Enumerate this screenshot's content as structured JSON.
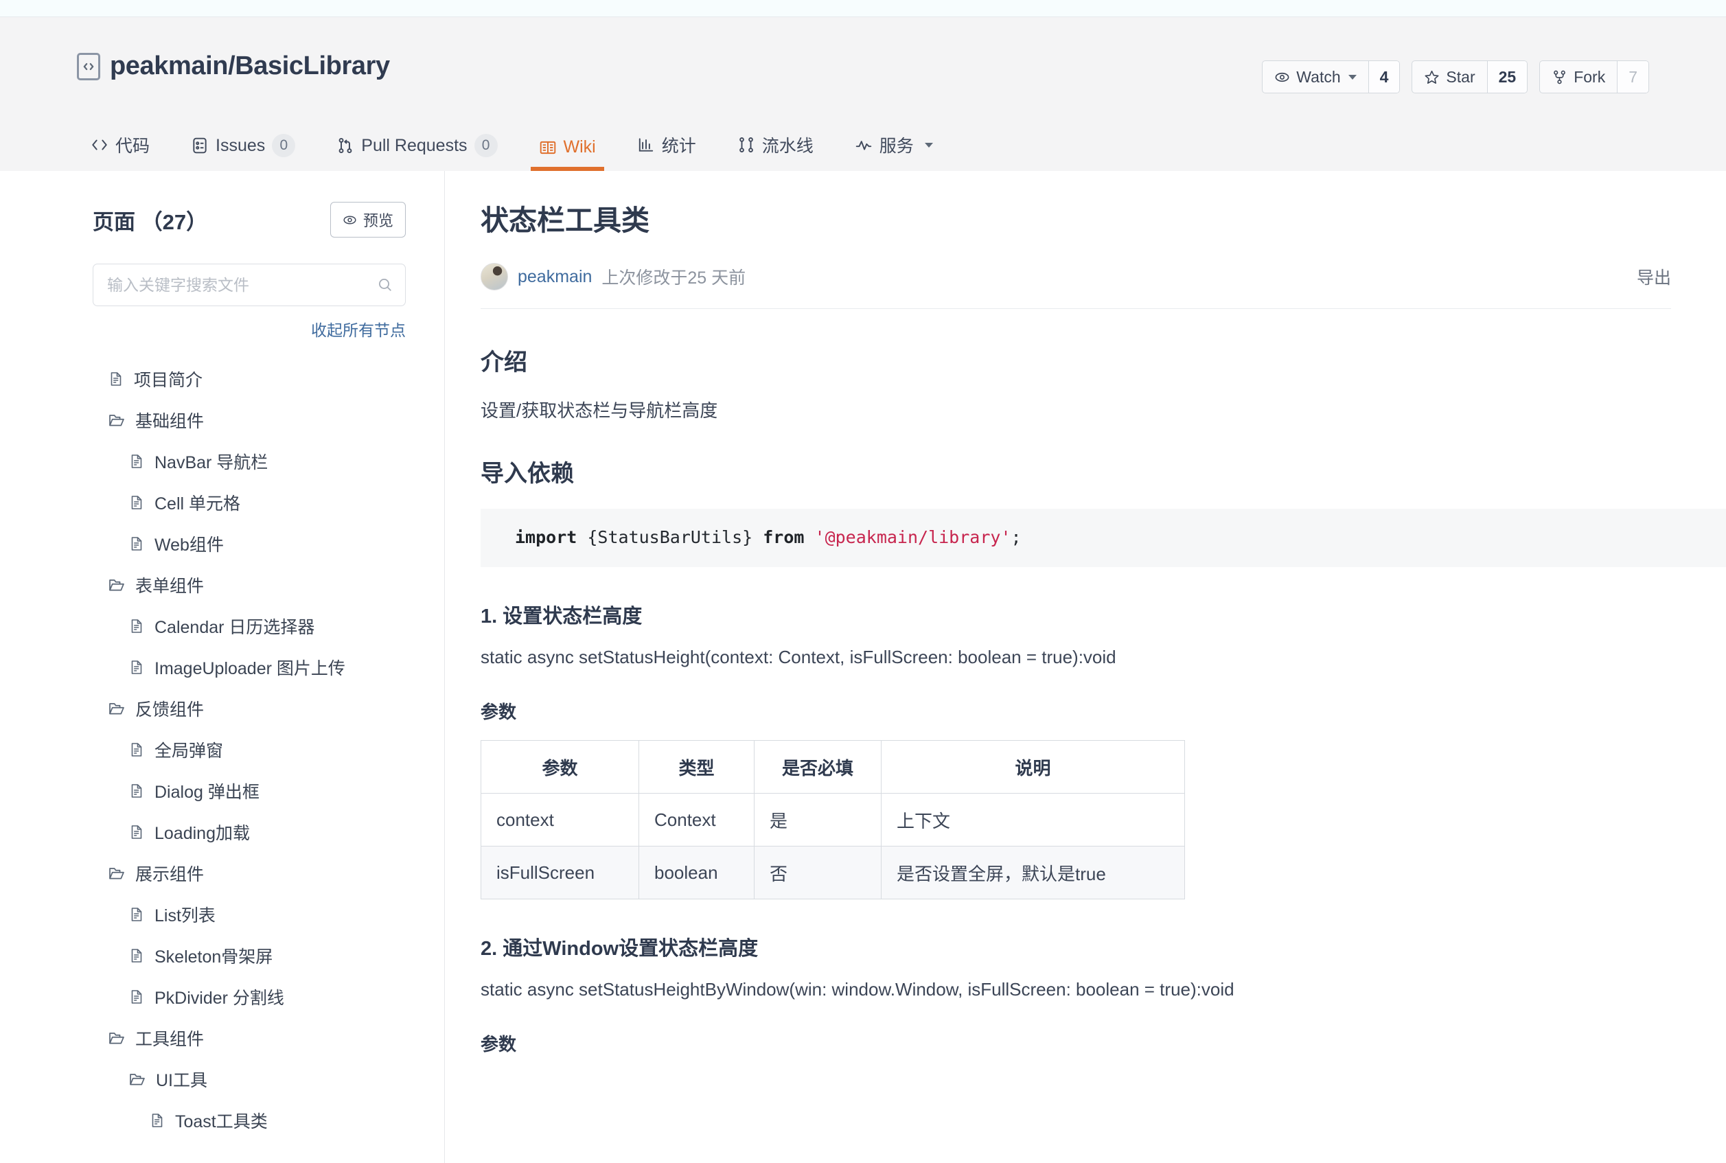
{
  "repo": {
    "icon": "repo-code-icon",
    "name": "peakmain/BasicLibrary",
    "actions": [
      {
        "icon": "eye-icon",
        "label": "Watch",
        "has_caret": true,
        "count": "4",
        "muted": false
      },
      {
        "icon": "star-icon",
        "label": "Star",
        "has_caret": false,
        "count": "25",
        "muted": false
      },
      {
        "icon": "fork-icon",
        "label": "Fork",
        "has_caret": false,
        "count": "7",
        "muted": true
      }
    ]
  },
  "nav": {
    "tabs": [
      {
        "icon": "code-icon",
        "label": "代码",
        "count": null,
        "active": false
      },
      {
        "icon": "issues-icon",
        "label": "Issues",
        "count": "0",
        "active": false
      },
      {
        "icon": "pull-request-icon",
        "label": "Pull Requests",
        "count": "0",
        "active": false
      },
      {
        "icon": "wiki-book-icon",
        "label": "Wiki",
        "count": null,
        "active": true
      },
      {
        "icon": "statistics-icon",
        "label": "统计",
        "count": null,
        "active": false
      },
      {
        "icon": "pipeline-icon",
        "label": "流水线",
        "count": null,
        "active": false
      },
      {
        "icon": "service-icon",
        "label": "服务",
        "count": null,
        "active": false,
        "caret": true
      }
    ]
  },
  "sidebar": {
    "title": "页面 （27）",
    "preview_label": "预览",
    "preview_icon": "eye-icon",
    "search": {
      "value": "",
      "placeholder": "输入关键字搜索文件",
      "icon": "search-icon"
    },
    "collapse_all_label": "收起所有节点",
    "tree": [
      {
        "label": "项目简介",
        "type": "file",
        "level": 0
      },
      {
        "label": "基础组件",
        "type": "folder",
        "level": 0
      },
      {
        "label": "NavBar 导航栏",
        "type": "file",
        "level": 1
      },
      {
        "label": "Cell 单元格",
        "type": "file",
        "level": 1
      },
      {
        "label": "Web组件",
        "type": "file",
        "level": 1
      },
      {
        "label": "表单组件",
        "type": "folder",
        "level": 0
      },
      {
        "label": "Calendar 日历选择器",
        "type": "file",
        "level": 1
      },
      {
        "label": "ImageUploader 图片上传",
        "type": "file",
        "level": 1
      },
      {
        "label": "反馈组件",
        "type": "folder",
        "level": 0
      },
      {
        "label": "全局弹窗",
        "type": "file",
        "level": 1
      },
      {
        "label": "Dialog 弹出框",
        "type": "file",
        "level": 1
      },
      {
        "label": "Loading加载",
        "type": "file",
        "level": 1
      },
      {
        "label": "展示组件",
        "type": "folder",
        "level": 0
      },
      {
        "label": "List列表",
        "type": "file",
        "level": 1
      },
      {
        "label": "Skeleton骨架屏",
        "type": "file",
        "level": 1
      },
      {
        "label": "PkDivider 分割线",
        "type": "file",
        "level": 1
      },
      {
        "label": "工具组件",
        "type": "folder",
        "level": 0
      },
      {
        "label": "UI工具",
        "type": "folder",
        "level": 1
      },
      {
        "label": "Toast工具类",
        "type": "file",
        "level": 2
      }
    ]
  },
  "doc": {
    "title": "状态栏工具类",
    "author": "peakmain",
    "modified_text": "上次修改于25 天前",
    "export_label": "导出",
    "section_intro_heading": "介绍",
    "section_intro_text": "设置/获取状态栏与导航栏高度",
    "section_import_heading": "导入依赖",
    "code": {
      "kw_import": "import",
      "binding": " {StatusBarUtils} ",
      "kw_from": "from",
      "module": " '@peakmain/library'",
      "semi": ";"
    },
    "section1_heading": "1. 设置状态栏高度",
    "section1_signature": "static async setStatusHeight(context: Context, isFullScreen: boolean = true):void",
    "section1_params_heading": "参数",
    "params_table": {
      "headers": [
        "参数",
        "类型",
        "是否必填",
        "说明"
      ],
      "rows": [
        [
          "context",
          "Context",
          "是",
          "上下文"
        ],
        [
          "isFullScreen",
          "boolean",
          "否",
          "是否设置全屏，默认是true"
        ]
      ]
    },
    "section2_heading": "2. 通过Window设置状态栏高度",
    "section2_signature": "static async setStatusHeightByWindow(win: window.Window, isFullScreen: boolean = true):void",
    "section2_params_heading": "参数"
  },
  "colors": {
    "accent": "#e0702d",
    "link": "#3f6b9e",
    "text": "#2f3a4e",
    "header_bg": "#f4f4f5",
    "code_bg": "#f6f7f8",
    "code_string": "#c7254e"
  }
}
